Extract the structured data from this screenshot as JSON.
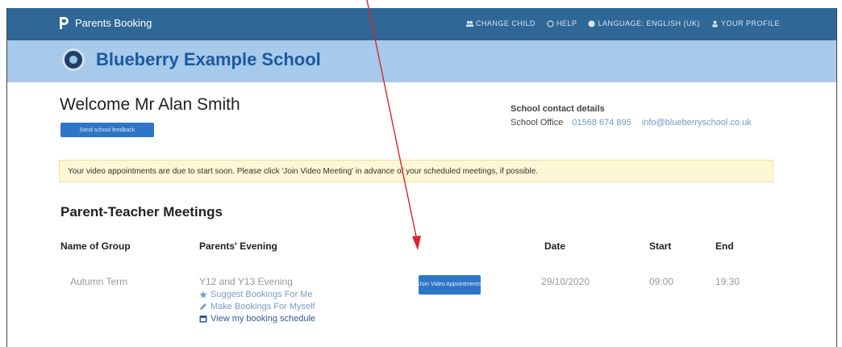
{
  "app": {
    "brand": "Parents Booking"
  },
  "nav": {
    "items": [
      {
        "label": "CHANGE CHILD",
        "icon": "users-icon"
      },
      {
        "label": "HELP",
        "icon": "help-icon"
      },
      {
        "label": "LANGUAGE: ENGLISH (UK)",
        "icon": "globe-icon"
      },
      {
        "label": "YOUR PROFILE",
        "icon": "user-icon"
      }
    ]
  },
  "school": {
    "name": "Blueberry Example School"
  },
  "welcome": "Welcome Mr Alan Smith",
  "feedback_button": "Send school feedback",
  "contact": {
    "title": "School contact details",
    "label": "School Office",
    "phone": "01568 674 895",
    "email": "info@blueberryschool.co.uk"
  },
  "notice": "Your video appointments are due to start soon. Please click 'Join Video Meeting' in advance of your scheduled meetings, if possible.",
  "meetings": {
    "title": "Parent-Teacher Meetings",
    "headers": {
      "group": "Name of Group",
      "evening": "Parents' Evening",
      "date": "Date",
      "start": "Start",
      "end": "End"
    },
    "row": {
      "group": "Autumn Term",
      "evening": "Y12 and Y13 Evening",
      "links": [
        {
          "label": "Suggest Bookings For Me",
          "icon": "star-icon"
        },
        {
          "label": "Make Bookings For Myself",
          "icon": "pencil-icon"
        },
        {
          "label": "View my booking schedule",
          "icon": "calendar-icon"
        }
      ],
      "join_button": "Join Video Appointments",
      "date": "29/10/2020",
      "start": "09:00",
      "end": "19:30"
    }
  },
  "colors": {
    "topbar": "#2f6796",
    "band": "#a7c9ea",
    "accent": "#2d76c7",
    "annotation": "#d9262c"
  }
}
